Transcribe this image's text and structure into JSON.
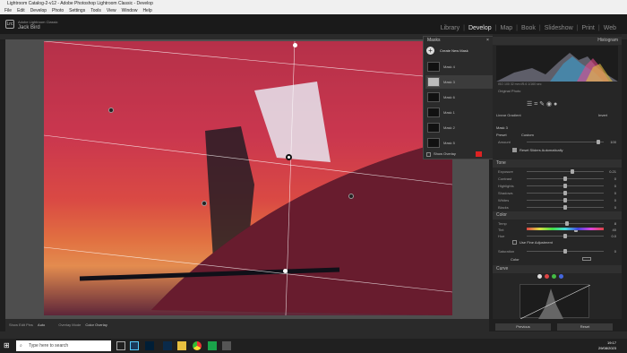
{
  "window": {
    "title": "Lightroom Catalog-2-v12 - Adobe Photoshop Lightroom Classic - Develop"
  },
  "menu": [
    "File",
    "Edit",
    "Develop",
    "Photo",
    "Settings",
    "Tools",
    "View",
    "Window",
    "Help"
  ],
  "identity": {
    "logo": "Lrc",
    "catalog": "Adobe Lightroom Classic",
    "user": "Jack Bird"
  },
  "modules": [
    "Library",
    "Develop",
    "Map",
    "Book",
    "Slideshow",
    "Print",
    "Web"
  ],
  "active_module": "Develop",
  "histogram": {
    "title": "Histogram",
    "stats": "ISO 100    32 mm    f/5.6    1/160 sec",
    "original": "Original Photo"
  },
  "masks": {
    "title": "Masks",
    "create": "Create New Mask",
    "items": [
      "Mask 4",
      "Mask 3",
      "Mask 6",
      "Mask 1",
      "Mask 2",
      "Mask 5"
    ],
    "show_overlay": "Show Overlay"
  },
  "mask_edit": {
    "type": "Linear Gradient",
    "invert": "Invert",
    "mask_label": "Mask 3",
    "preset_label": "Preset",
    "preset_value": "Custom",
    "amount_label": "Amount",
    "amount_value": "100",
    "reset_label": "Reset Sliders Automatically"
  },
  "tone": {
    "title": "Tone",
    "sliders": [
      {
        "label": "Exposure",
        "value": "0.21",
        "pos": 0.6
      },
      {
        "label": "Contrast",
        "value": "0",
        "pos": 0.5
      },
      {
        "label": "Highlights",
        "value": "0",
        "pos": 0.5
      },
      {
        "label": "Shadows",
        "value": "0",
        "pos": 0.5
      },
      {
        "label": "Whites",
        "value": "0",
        "pos": 0.5
      },
      {
        "label": "Blacks",
        "value": "0",
        "pos": 0.5
      }
    ]
  },
  "color": {
    "title": "Color",
    "sliders": [
      {
        "label": "Temp",
        "value": "8",
        "pos": 0.52
      },
      {
        "label": "Tint",
        "value": "40",
        "pos": 0.65
      },
      {
        "label": "Hue",
        "value": "0.0",
        "pos": 0.5
      }
    ],
    "fine": "Use Fine Adjustment",
    "sat_label": "Saturation",
    "sat_value": "0",
    "color_label": "Color"
  },
  "curve": {
    "title": "Curve"
  },
  "bottom": {
    "show_edit_pins": "Show Edit Pins",
    "auto": "Auto",
    "overlay_mode": "Overlay Mode",
    "overlay_value": "Color Overlay"
  },
  "buttons": {
    "previous": "Previous",
    "reset": "Reset"
  },
  "taskbar": {
    "search": "Type here to search",
    "time": "19:17",
    "date": "29/08/2023"
  }
}
